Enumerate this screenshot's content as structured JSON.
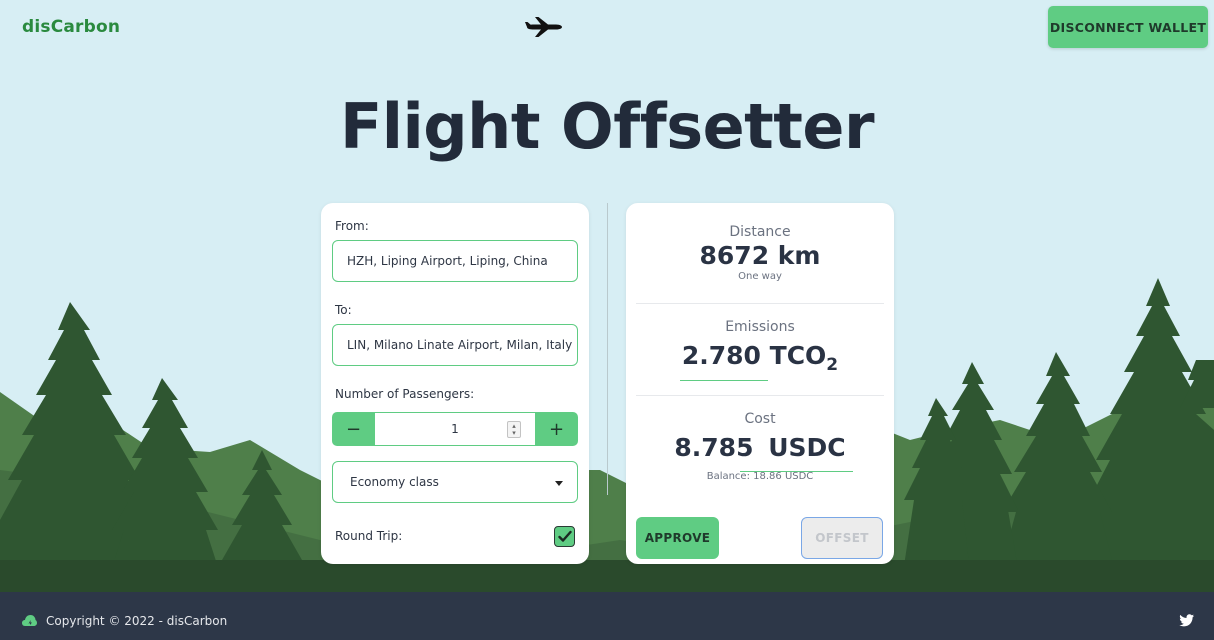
{
  "header": {
    "brand": "disCarbon",
    "disconnect_label": "DISCONNECT WALLET"
  },
  "page_title": "Flight Offsetter",
  "form": {
    "from_label": "From:",
    "from_value": "HZH, Liping Airport, Liping, China",
    "to_label": "To:",
    "to_value": "LIN, Milano Linate Airport, Milan, Italy",
    "passengers_label": "Number of Passengers:",
    "passengers_value": "1",
    "minus_label": "−",
    "plus_label": "+",
    "class_value": "Economy class",
    "round_trip_label": "Round Trip:",
    "round_trip_checked": true
  },
  "summary": {
    "distance_label": "Distance",
    "distance_value": "8672 km",
    "distance_note": "One way",
    "emissions_label": "Emissions",
    "emissions_value": "2.780",
    "emissions_unit": "TCO",
    "emissions_subscript": "2",
    "cost_label": "Cost",
    "cost_value": "8.785",
    "cost_currency": "USDC",
    "balance": "Balance: 18.86 USDC",
    "approve_label": "APPROVE",
    "offset_label": "OFFSET"
  },
  "footer": {
    "copyright": "Copyright © 2022 - disCarbon"
  },
  "colors": {
    "accent": "#5fcc83",
    "brand": "#2a8a3f",
    "sky": "#d7eef4",
    "forest_dark": "#2f4f2f",
    "forest_mid": "#3f6b3f",
    "footer": "#2d3748"
  },
  "icons": [
    "airplane-icon",
    "leaf-icon",
    "twitter-icon",
    "checkmark-icon",
    "chevron-down-icon",
    "spin-arrows-icon"
  ]
}
